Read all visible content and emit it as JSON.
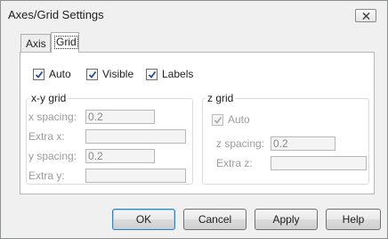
{
  "window": {
    "title": "Axes/Grid Settings"
  },
  "tabs": [
    {
      "label": "Axis",
      "active": false
    },
    {
      "label": "Grid",
      "active": true
    }
  ],
  "options": {
    "auto": {
      "label": "Auto",
      "checked": true
    },
    "visible": {
      "label": "Visible",
      "checked": true
    },
    "labels": {
      "label": "Labels",
      "checked": true
    }
  },
  "xy_grid": {
    "title": "x-y grid",
    "x_spacing_label": "x spacing:",
    "x_spacing_value": "0.2",
    "extra_x_label": "Extra x:",
    "extra_x_value": "",
    "y_spacing_label": "y spacing:",
    "y_spacing_value": "0.2",
    "extra_y_label": "Extra y:",
    "extra_y_value": ""
  },
  "z_grid": {
    "title": "z grid",
    "auto_label": "Auto",
    "auto_checked": true,
    "z_spacing_label": "z spacing:",
    "z_spacing_value": "0.2",
    "extra_z_label": "Extra z:",
    "extra_z_value": ""
  },
  "buttons": {
    "ok": "OK",
    "cancel": "Cancel",
    "apply": "Apply",
    "help": "Help"
  },
  "colors": {
    "checkmark": "#2a4c8c",
    "disabled_text": "#9c9c9c",
    "default_button_border": "#3c7fb1"
  }
}
